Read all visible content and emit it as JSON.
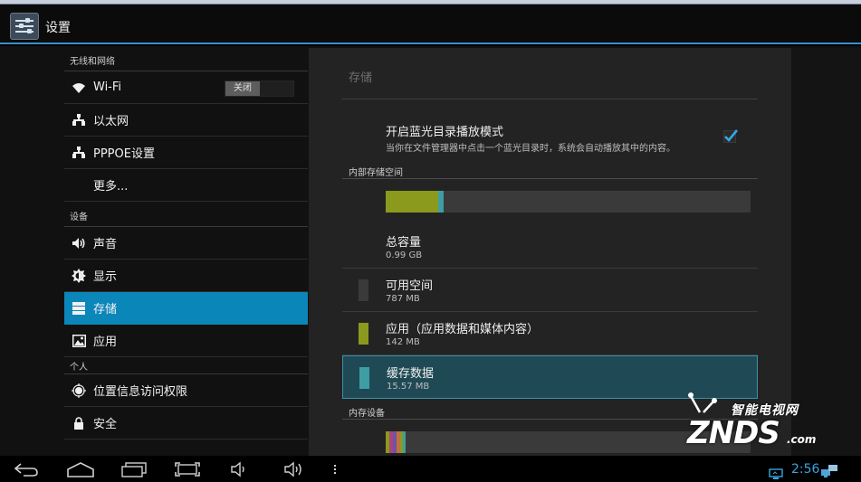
{
  "app": {
    "title": "设置"
  },
  "sidebar": {
    "sections": [
      {
        "header": "无线和网络",
        "items": [
          {
            "label": "Wi-Fi",
            "icon": "wifi-icon",
            "toggle": "关闭"
          },
          {
            "label": "以太网",
            "icon": "ethernet-icon"
          },
          {
            "label": "PPPOE设置",
            "icon": "ethernet-icon"
          },
          {
            "label": "更多...",
            "icon": null
          }
        ]
      },
      {
        "header": "设备",
        "items": [
          {
            "label": "声音",
            "icon": "volume-icon"
          },
          {
            "label": "显示",
            "icon": "brightness-icon"
          },
          {
            "label": "存储",
            "icon": "storage-icon",
            "selected": true
          },
          {
            "label": "应用",
            "icon": "apps-icon"
          }
        ]
      },
      {
        "header": "个人",
        "items": [
          {
            "label": "位置信息访问权限",
            "icon": "location-icon"
          },
          {
            "label": "安全",
            "icon": "lock-icon"
          }
        ]
      }
    ]
  },
  "storage": {
    "title": "存储",
    "bluray": {
      "title": "开启蓝光目录播放模式",
      "description": "当你在文件管理器中点击一个蓝光目录时，系统会自动播放其中的内容。",
      "checked": true
    },
    "internal_label": "内部存储空间",
    "usage_fractions": {
      "apps": 0.143,
      "cache": 0.016
    },
    "rows": [
      {
        "title": "总容量",
        "value": "0.99 GB",
        "color": null
      },
      {
        "title": "可用空间",
        "value": "787 MB",
        "color": "#3a3a3a"
      },
      {
        "title": "应用（应用数据和媒体内容）",
        "value": "142 MB",
        "color": "#8b9a1c"
      },
      {
        "title": "缓存数据",
        "value": "15.57 MB",
        "color": "#3f9ea4",
        "highlighted": true
      }
    ],
    "memory_label": "内存设备"
  },
  "watermark": {
    "cn": "智能电视网",
    "brand": "ZNDS",
    "suffix": ".com"
  },
  "status": {
    "time": "2:56"
  },
  "colors": {
    "accent": "#0b86b9",
    "clock": "#36a6e0",
    "apps": "#8b9a1c",
    "cache": "#3f9ea4"
  }
}
